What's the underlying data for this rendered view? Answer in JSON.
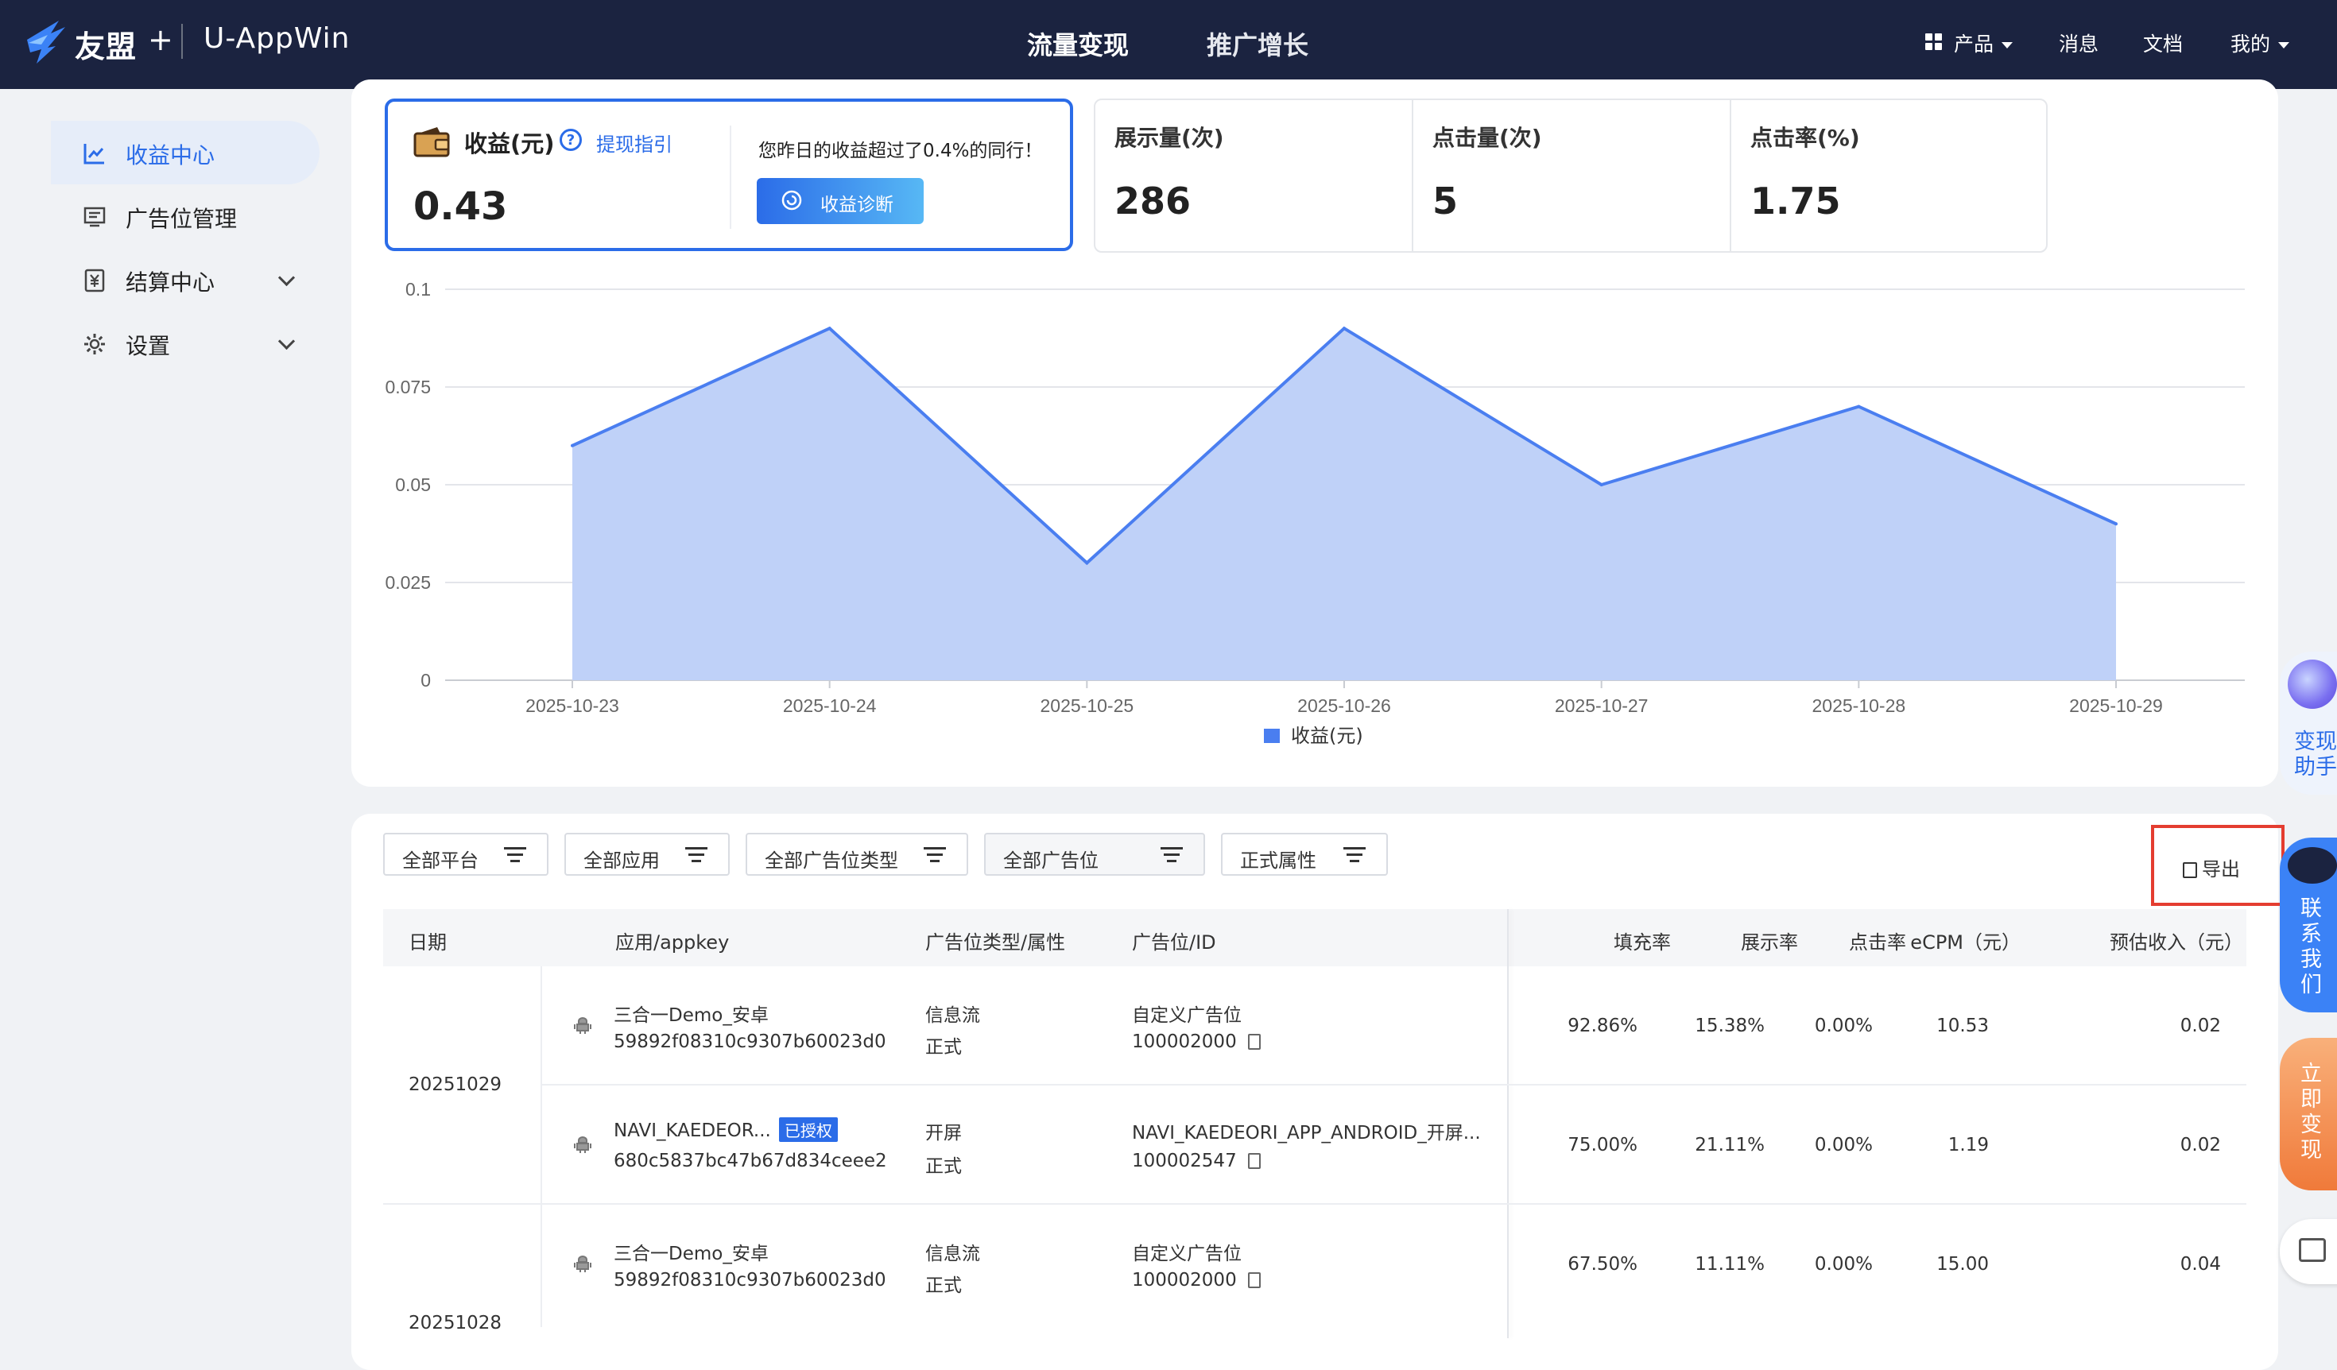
{
  "header": {
    "brand": "友盟",
    "brand_plus": "+",
    "app_name": "U-AppWin",
    "tabs": [
      {
        "label": "流量变现"
      },
      {
        "label": "推广增长"
      }
    ],
    "right": {
      "products": "产品",
      "messages": "消息",
      "docs": "文档",
      "mine": "我的"
    }
  },
  "sidebar": {
    "items": [
      {
        "label": "收益中心",
        "icon": "line-chart-icon",
        "active": true
      },
      {
        "label": "广告位管理",
        "icon": "monitor-icon"
      },
      {
        "label": "结算中心",
        "icon": "yuan-icon",
        "expandable": true
      },
      {
        "label": "设置",
        "icon": "gear-icon",
        "expandable": true
      }
    ]
  },
  "revenue_card": {
    "title": "收益(元)",
    "help_icon": "?",
    "link": "提现指引",
    "value": "0.43",
    "note": "您昨日的收益超过了0.4%的同行！",
    "diagnose_button": "收益诊断"
  },
  "metrics": [
    {
      "label": "展示量(次)",
      "value": "286"
    },
    {
      "label": "点击量(次)",
      "value": "5"
    },
    {
      "label": "点击率(%)",
      "value": "1.75"
    }
  ],
  "chart_data": {
    "type": "area",
    "x": [
      "2025-10-23",
      "2025-10-24",
      "2025-10-25",
      "2025-10-26",
      "2025-10-27",
      "2025-10-28",
      "2025-10-29"
    ],
    "series": [
      {
        "name": "收益(元)",
        "values": [
          0.06,
          0.09,
          0.03,
          0.09,
          0.05,
          0.07,
          0.04
        ]
      }
    ],
    "yticks": [
      "0.1",
      "0.075",
      "0.05",
      "0.025",
      "0"
    ],
    "ylim": [
      0,
      0.1
    ],
    "grid": true,
    "legend": "bottom",
    "color": "#4a7ef0"
  },
  "filters": [
    {
      "label": "全部平台"
    },
    {
      "label": "全部应用"
    },
    {
      "label": "全部广告位类型"
    },
    {
      "label": "全部广告位"
    },
    {
      "label": "正式属性"
    }
  ],
  "export_label": "导出",
  "table": {
    "headers": {
      "date": "日期",
      "app": "应用/appkey",
      "type": "广告位类型/属性",
      "slot": "广告位/ID",
      "fill": "填充率",
      "show": "展示率",
      "click": "点击率",
      "ecpm": "eCPM（元）",
      "income": "预估收入（元）"
    },
    "dates": [
      "20251029",
      "20251028"
    ],
    "rows": [
      {
        "app": "三合一Demo_安卓",
        "appkey": "59892f08310c9307b60023d0",
        "type": "信息流",
        "attr": "正式",
        "slot": "自定义广告位",
        "slot_id": "100002000",
        "fill": "92.86%",
        "show": "15.38%",
        "click": "0.00%",
        "ecpm": "10.53",
        "income": "0.02"
      },
      {
        "app": "NAVI_KAEDEOR...",
        "badge": "已授权",
        "appkey": "680c5837bc47b67d834ceee2",
        "type": "开屏",
        "attr": "正式",
        "slot": "NAVI_KAEDEORI_APP_ANDROID_开屏...",
        "slot_id": "100002547",
        "fill": "75.00%",
        "show": "21.11%",
        "click": "0.00%",
        "ecpm": "1.19",
        "income": "0.02"
      },
      {
        "app": "三合一Demo_安卓",
        "appkey": "59892f08310c9307b60023d0",
        "type": "信息流",
        "attr": "正式",
        "slot": "自定义广告位",
        "slot_id": "100002000",
        "fill": "67.50%",
        "show": "11.11%",
        "click": "0.00%",
        "ecpm": "15.00",
        "income": "0.04"
      }
    ]
  },
  "float_widgets": {
    "assistant": "变现助手",
    "contact": "联系我们",
    "monetize": "立即变现"
  }
}
